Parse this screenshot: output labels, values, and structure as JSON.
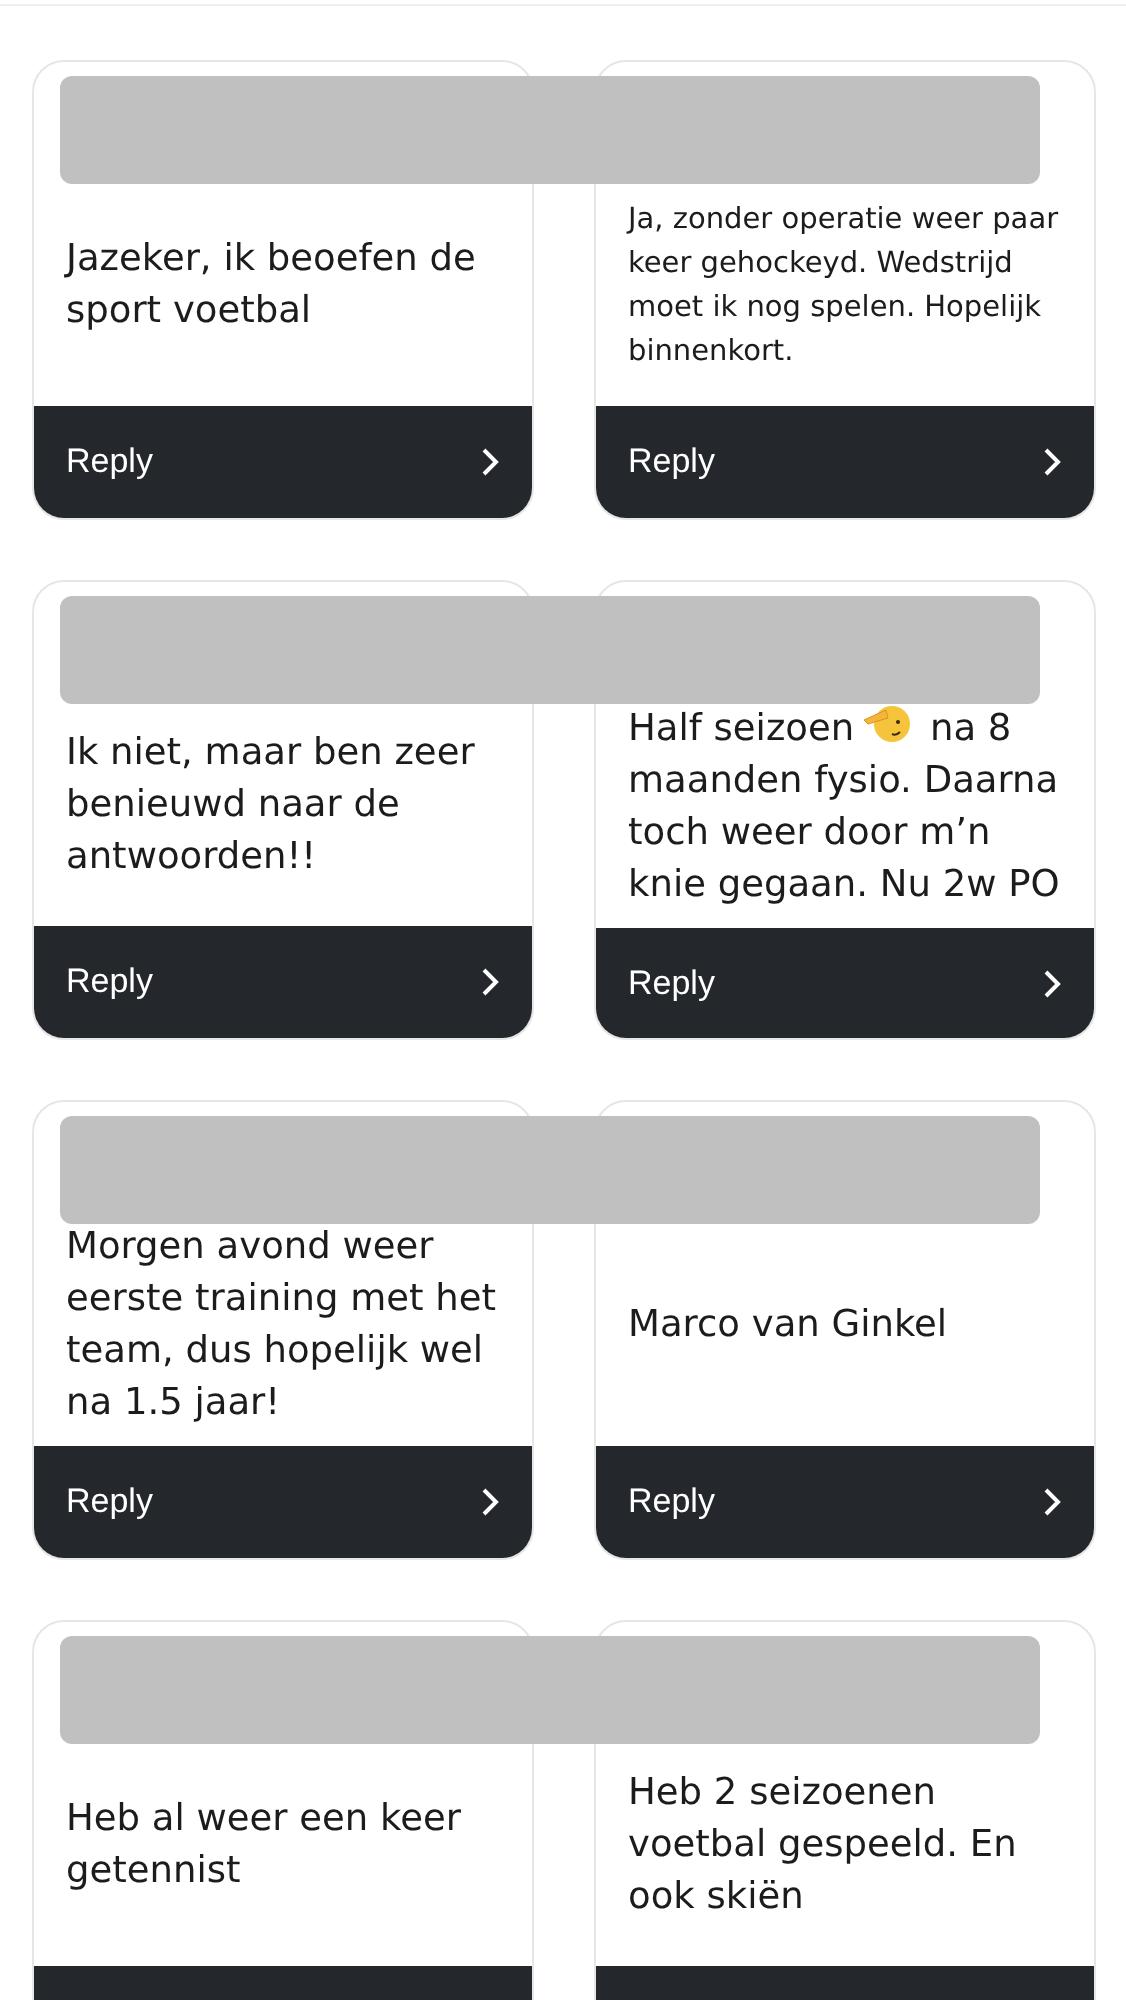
{
  "rows": [
    {
      "redacted": true,
      "cards": [
        {
          "parts": [
            {
              "kind": "paragraph",
              "text": "Jazeker, ik beoefen de sport voetbal"
            }
          ],
          "reply": "Reply"
        },
        {
          "parts": [
            {
              "kind": "paragraph",
              "text": "Ja, zonder operatie weer paar keer gehockeyd. Wedstrijd moet ik nog spelen. Hopelijk binnenkort."
            }
          ],
          "reply": "Reply"
        }
      ]
    },
    {
      "redacted": true,
      "cards": [
        {
          "parts": [
            {
              "kind": "paragraph",
              "text": "Ik niet, maar ben zeer benieuwd naar de antwoorden!!"
            }
          ],
          "reply": "Reply"
        },
        {
          "parts": [
            {
              "kind": "phrase",
              "text": "Half seizoen"
            },
            {
              "kind": "emoji"
            },
            {
              "kind": "phrase",
              "text": "na 8"
            },
            {
              "kind": "paragraph",
              "text": "maanden fysio. Daarna toch weer door m’n knie gegaan. Nu 2w PO"
            }
          ],
          "reply": "Reply"
        }
      ]
    },
    {
      "redacted": true,
      "cards": [
        {
          "parts": [
            {
              "kind": "paragraph",
              "text": "Morgen avond weer eerste training met het team, dus hopelijk wel na 1.5 jaar!"
            }
          ],
          "reply": "Reply"
        },
        {
          "parts": [
            {
              "kind": "paragraph",
              "text": "Marco van Ginkel"
            }
          ],
          "reply": "Reply"
        }
      ]
    },
    {
      "redacted": true,
      "cards": [
        {
          "parts": [
            {
              "kind": "paragraph",
              "text": "Heb al weer een keer getennist"
            }
          ]
        },
        {
          "parts": [
            {
              "kind": "paragraph",
              "text": "Heb 2 seizoenen voetbal gespeeld. En ook skiën"
            }
          ]
        }
      ]
    }
  ]
}
